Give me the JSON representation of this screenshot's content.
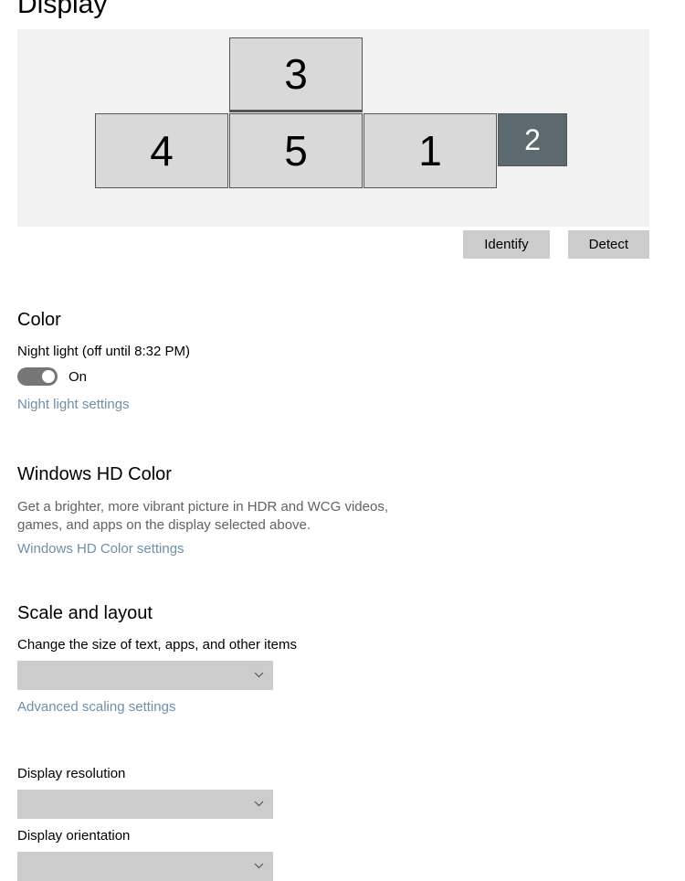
{
  "page": {
    "title": "Display"
  },
  "monitors": {
    "m1": "1",
    "m2": "2",
    "m3": "3",
    "m4": "4",
    "m5": "5"
  },
  "actions": {
    "identify": "Identify",
    "detect": "Detect"
  },
  "color": {
    "heading": "Color",
    "night_light_label": "Night light (off until 8:32 PM)",
    "toggle_state": "On",
    "settings_link": "Night light settings"
  },
  "hd": {
    "heading": "Windows HD Color",
    "description": "Get a brighter, more vibrant picture in HDR and WCG videos, games, and apps on the display selected above.",
    "settings_link": "Windows HD Color settings"
  },
  "scale": {
    "heading": "Scale and layout",
    "size_label": "Change the size of text, apps, and other items",
    "advanced_link": "Advanced scaling settings",
    "resolution_label": "Display resolution",
    "orientation_label": "Display orientation"
  }
}
